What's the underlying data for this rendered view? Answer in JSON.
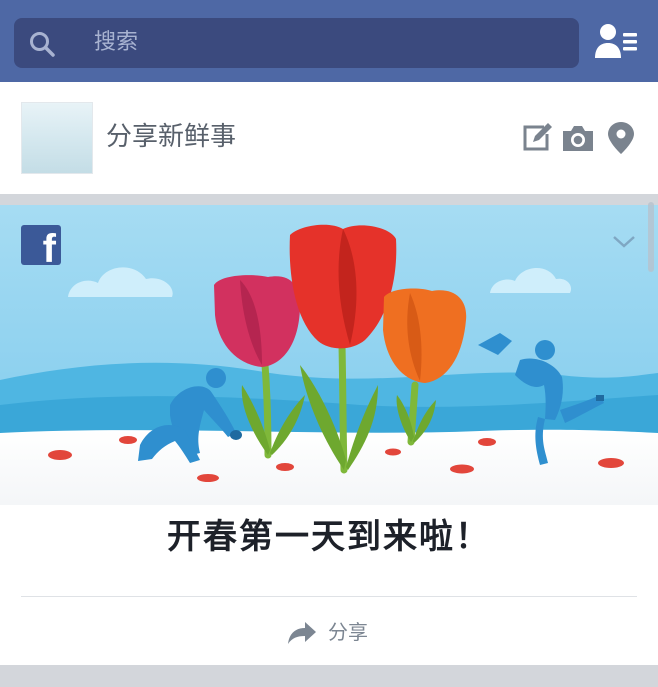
{
  "search": {
    "placeholder": "搜索"
  },
  "icons": {
    "search": "search-icon",
    "friends": "friend-requests-icon",
    "edit": "edit-post-icon",
    "camera": "camera-icon",
    "location": "location-pin-icon",
    "brand": "facebook-logo-icon",
    "menu": "chevron-down-icon",
    "share": "share-arrow-icon"
  },
  "composer": {
    "prompt": "分享新鲜事"
  },
  "story": {
    "headline": "开春第一天到来啦！",
    "share_label": "分享"
  },
  "colors": {
    "header": "#4e68a5",
    "search_bg": "#3b4a7e",
    "brand": "#3b5998",
    "sky": "#8fd3f0"
  }
}
